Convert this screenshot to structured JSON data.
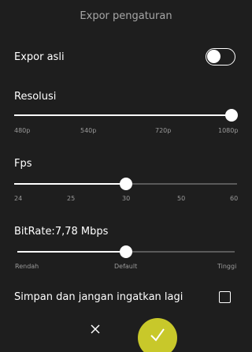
{
  "header": {
    "title": "Expor pengaturan"
  },
  "export_original": {
    "label": "Expor asli",
    "enabled": false
  },
  "resolution": {
    "label": "Resolusi",
    "ticks": [
      "480p",
      "540p",
      "720p",
      "1080p"
    ],
    "value": "1080p"
  },
  "fps": {
    "label": "Fps",
    "ticks": [
      "24",
      "25",
      "30",
      "50",
      "60"
    ],
    "value": "30"
  },
  "bitrate": {
    "label": "BitRate:7,78 Mbps",
    "ticks": [
      "Rendah",
      "Default",
      "Tinggi"
    ],
    "value": "Default"
  },
  "remember": {
    "label": "Simpan dan jangan ingatkan lagi",
    "checked": false
  },
  "actions": {
    "cancel_icon": "close-icon",
    "confirm_icon": "check-icon"
  },
  "colors": {
    "background": "#1e1e1e",
    "accent": "#c8c82a",
    "track_inactive": "#5a5a5a"
  }
}
